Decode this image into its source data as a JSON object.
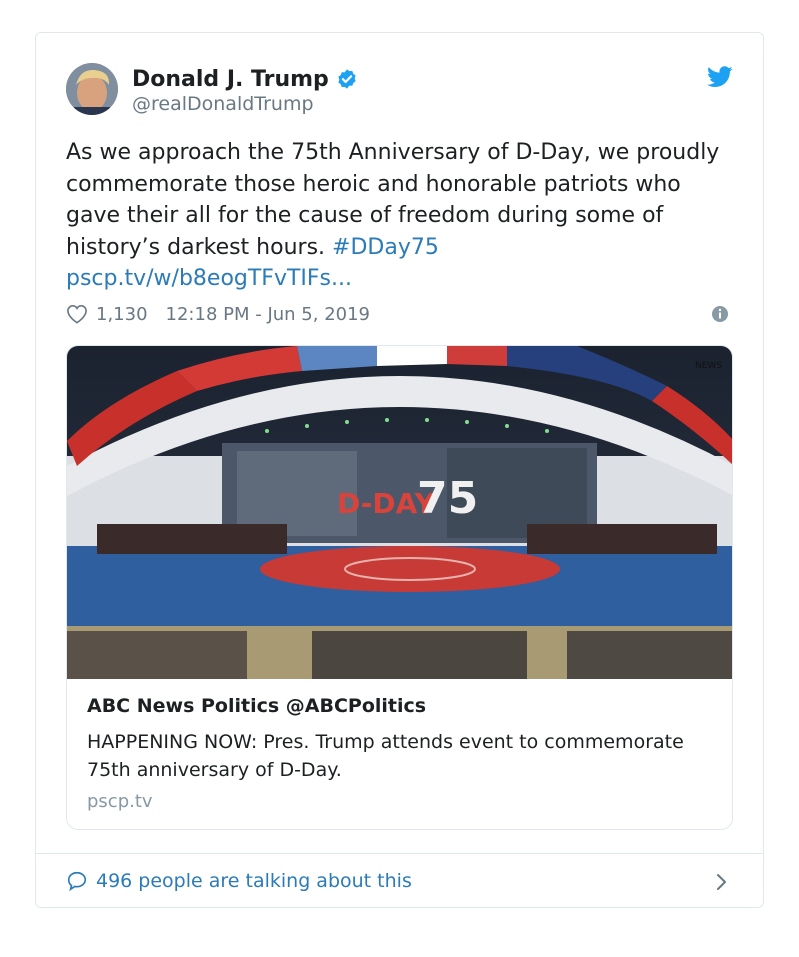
{
  "tweet": {
    "author_name": "Donald J. Trump",
    "author_handle": "@realDonaldTrump",
    "text_main": "As we approach the 75th Anniversary of D-Day, we proudly commemorate those heroic and honorable patriots who gave their all for the cause of freedom during some of history’s darkest hours.",
    "hashtag": "#DDay75",
    "link": "pscp.tv/w/b8eogTFvTIFs...",
    "likes": "1,130",
    "timestamp": "12:18 PM - Jun 5, 2019"
  },
  "media": {
    "title": "ABC News Politics @ABCPolitics",
    "description": "HAPPENING NOW: Pres. Trump attends event to commemorate 75th anniversary of D-Day.",
    "domain": "pscp.tv",
    "image_text_dday": "D-DAY",
    "image_text_75": "75",
    "image_logo_text": "NEWS"
  },
  "footer": {
    "talking": "496 people are talking about this"
  },
  "colors": {
    "link": "#2b7bb9",
    "verified": "#1da1f2",
    "muted": "#697882",
    "border": "#e1e8ed"
  },
  "icons": [
    "verified-badge-icon",
    "twitter-bird-icon",
    "heart-icon",
    "info-icon",
    "speech-bubble-icon",
    "chevron-right-icon"
  ]
}
